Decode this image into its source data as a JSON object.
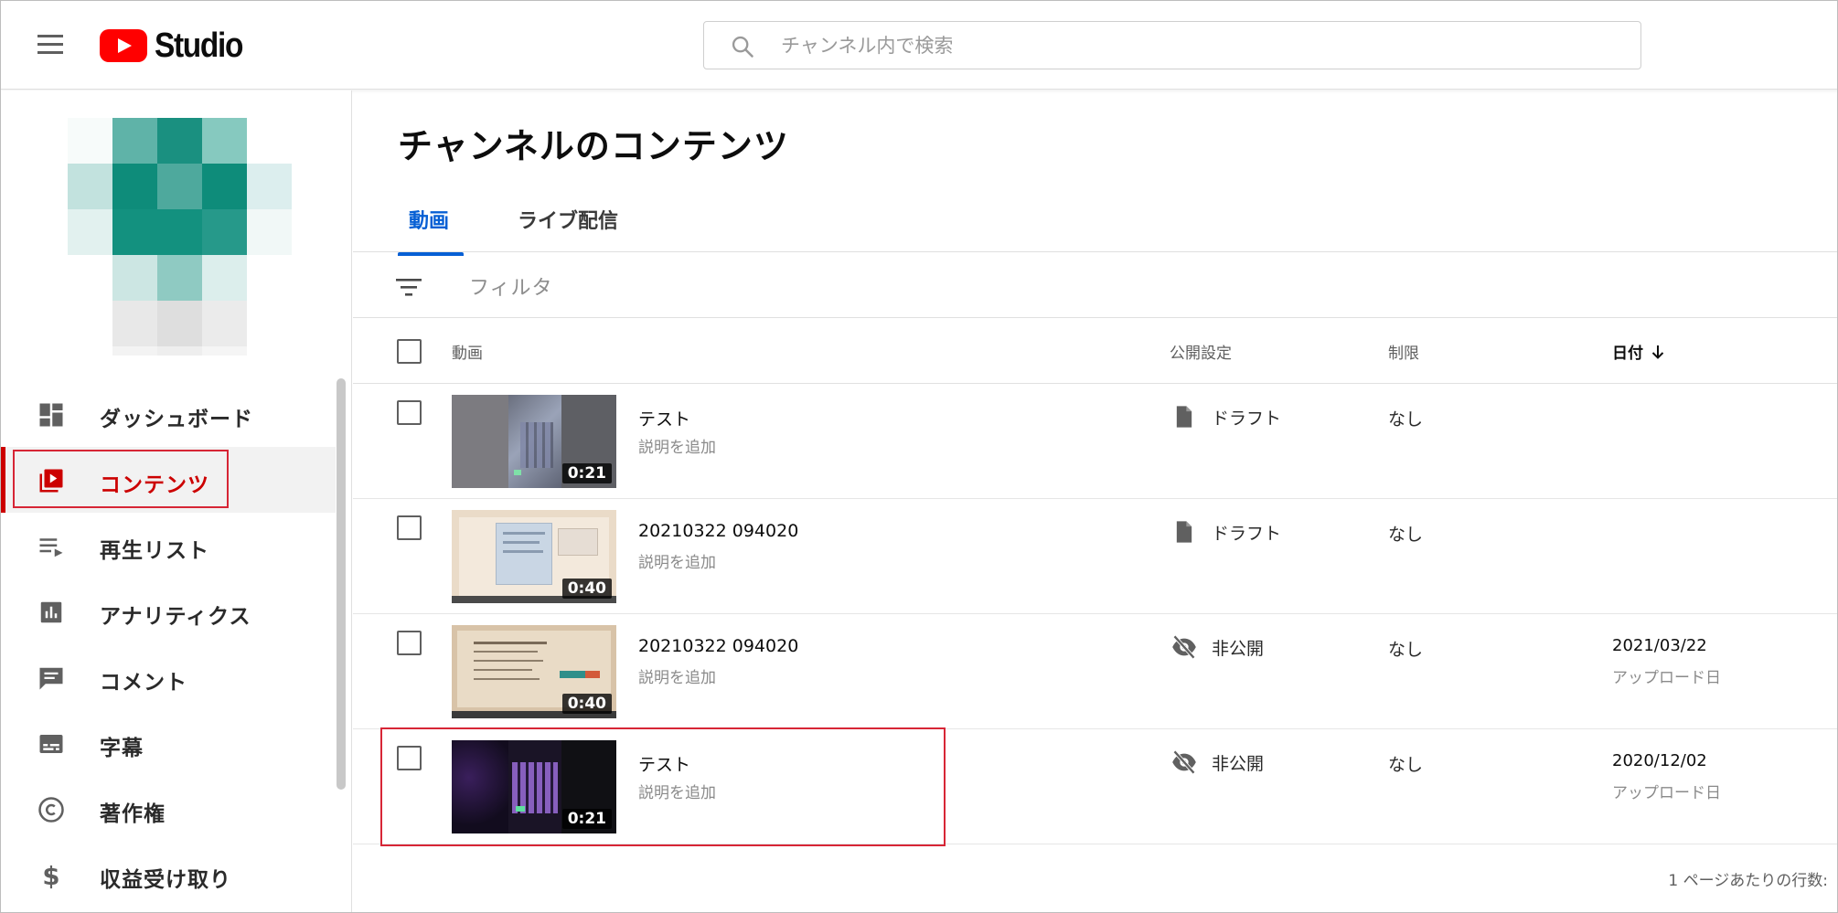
{
  "app": {
    "logo_text": "Studio",
    "brand_color": "#ff0000",
    "accent_color": "#065fd4"
  },
  "header": {
    "search_placeholder": "チャンネル内で検索"
  },
  "sidebar": {
    "items": [
      {
        "label": "ダッシュボード",
        "icon": "dashboard-icon",
        "active": false
      },
      {
        "label": "コンテンツ",
        "icon": "content-icon",
        "active": true
      },
      {
        "label": "再生リスト",
        "icon": "playlist-icon",
        "active": false
      },
      {
        "label": "アナリティクス",
        "icon": "analytics-icon",
        "active": false
      },
      {
        "label": "コメント",
        "icon": "comment-icon",
        "active": false
      },
      {
        "label": "字幕",
        "icon": "subtitles-icon",
        "active": false
      },
      {
        "label": "著作権",
        "icon": "copyright-icon",
        "active": false
      },
      {
        "label": "収益受け取り",
        "icon": "dollar-icon",
        "active": false
      }
    ]
  },
  "main": {
    "title": "チャンネルのコンテンツ",
    "tabs": [
      {
        "label": "動画",
        "active": true
      },
      {
        "label": "ライブ配信",
        "active": false
      }
    ],
    "filter_placeholder": "フィルタ",
    "columns": {
      "video": "動画",
      "visibility": "公開設定",
      "restrictions": "制限",
      "date": "日付"
    },
    "rows": [
      {
        "title": "テスト",
        "description": "説明を追加",
        "duration": "0:21",
        "visibility": "ドラフト",
        "visibility_icon": "draft-icon",
        "restrictions": "なし",
        "date": "",
        "date_label": ""
      },
      {
        "title": "20210322 094020",
        "description": "説明を追加",
        "duration": "0:40",
        "visibility": "ドラフト",
        "visibility_icon": "draft-icon",
        "restrictions": "なし",
        "date": "",
        "date_label": ""
      },
      {
        "title": "20210322 094020",
        "description": "説明を追加",
        "duration": "0:40",
        "visibility": "非公開",
        "visibility_icon": "private-icon",
        "restrictions": "なし",
        "date": "2021/03/22",
        "date_label": "アップロード日"
      },
      {
        "title": "テスト",
        "description": "説明を追加",
        "duration": "0:21",
        "visibility": "非公開",
        "visibility_icon": "private-icon",
        "restrictions": "なし",
        "date": "2020/12/02",
        "date_label": "アップロード日"
      }
    ],
    "footer": {
      "rows_per_page_label": "1 ページあたりの行数:"
    }
  }
}
